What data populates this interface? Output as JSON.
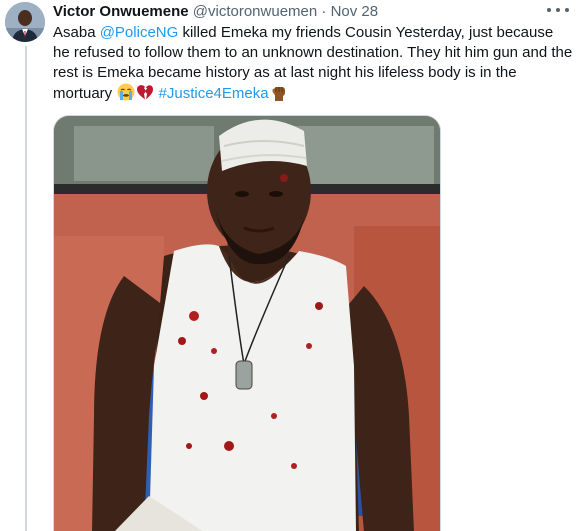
{
  "author": {
    "display_name": "Victor Onwuemene",
    "handle": "@victoronwuemen",
    "separator": "·",
    "date": "Nov 28"
  },
  "tweet": {
    "text_before_mention": "Asaba ",
    "mention": "@PoliceNG",
    "text_after_mention": " killed Emeka my friends Cousin Yesterday, just because he refused to follow them to an unknown destination. They hit him gun and the rest is Emeka became history as at last night his lifeless body is in the mortuary ",
    "hashtag": "#Justice4Emeka",
    "emojis": [
      "crying-face-emoji",
      "broken-heart-emoji",
      "raised-fist-emoji"
    ]
  },
  "icons": {
    "more": "more-horizontal-icon"
  },
  "colors": {
    "link": "#1d9bf0",
    "secondary_text": "#536471",
    "primary_text": "#0f1419",
    "thread_line": "#cfd9de"
  }
}
